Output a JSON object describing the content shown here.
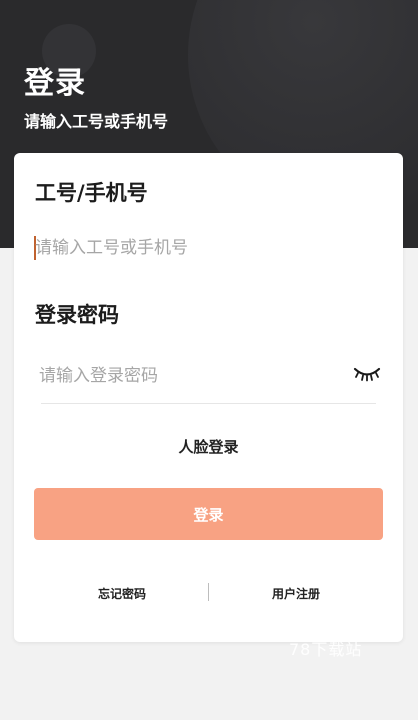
{
  "header": {
    "title": "登录",
    "subtitle": "请输入工号或手机号"
  },
  "form": {
    "account_label": "工号/手机号",
    "account_placeholder": "请输入工号或手机号",
    "password_label": "登录密码",
    "password_placeholder": "请输入登录密码",
    "password_toggle_icon": "eye-closed-icon",
    "face_login_label": "人脸登录",
    "submit_label": "登录",
    "submit_color": "#f8a283"
  },
  "footer": {
    "forgot_label": "忘记密码",
    "register_label": "用户注册"
  },
  "watermark": "78下载站"
}
